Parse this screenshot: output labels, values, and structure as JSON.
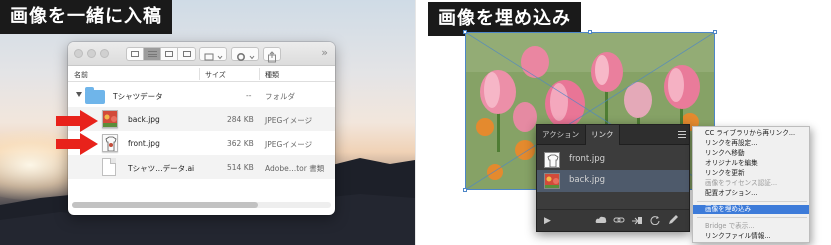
{
  "left_panel": {
    "title": "画像を一緒に入稿",
    "finder": {
      "columns": {
        "name": "名前",
        "size": "サイズ",
        "kind": "種類"
      },
      "overflow_label": "»",
      "rows": [
        {
          "name": "Tシャツデータ",
          "size": "--",
          "kind": "フォルダ",
          "icon": "folder-icon"
        },
        {
          "name": "back.jpg",
          "size": "284 KB",
          "kind": "JPEGイメージ",
          "icon": "jpg-thumbnail"
        },
        {
          "name": "front.jpg",
          "size": "362 KB",
          "kind": "JPEGイメージ",
          "icon": "jpg-thumbnail"
        },
        {
          "name": "Tシャツ…データ.ai",
          "size": "514 KB",
          "kind": "Adobe…tor 書類",
          "icon": "ai-document-icon"
        }
      ]
    }
  },
  "right_panel": {
    "title": "画像を埋め込み",
    "links_panel": {
      "tabs": [
        "アクション",
        "リンク"
      ],
      "active_tab": "リンク",
      "links": [
        {
          "name": "front.jpg",
          "selected": false
        },
        {
          "name": "back.jpg",
          "selected": true
        }
      ]
    },
    "context_menu": {
      "items": [
        {
          "label": "CC ライブラリから再リンク...",
          "disabled": false,
          "highlighted": false
        },
        {
          "label": "リンクを再設定...",
          "disabled": false,
          "highlighted": false
        },
        {
          "label": "リンクへ移動",
          "disabled": false,
          "highlighted": false
        },
        {
          "label": "オリジナルを編集",
          "disabled": false,
          "highlighted": false
        },
        {
          "label": "リンクを更新",
          "disabled": false,
          "highlighted": false
        },
        {
          "label": "画像をライセンス認証...",
          "disabled": true,
          "highlighted": false
        },
        {
          "label": "配置オプション...",
          "disabled": false,
          "highlighted": false
        },
        {
          "label": "画像を埋め込み",
          "disabled": false,
          "highlighted": true
        },
        {
          "label": "Bridge で表示...",
          "disabled": true,
          "highlighted": false
        },
        {
          "label": "リンクファイル情報...",
          "disabled": false,
          "highlighted": false
        }
      ]
    }
  },
  "colors": {
    "title_bg": "#1a1a1a",
    "arrow_red": "#e8221b",
    "selection_blue": "#3d7bd9",
    "panel_dark": "#3c3c3c"
  }
}
